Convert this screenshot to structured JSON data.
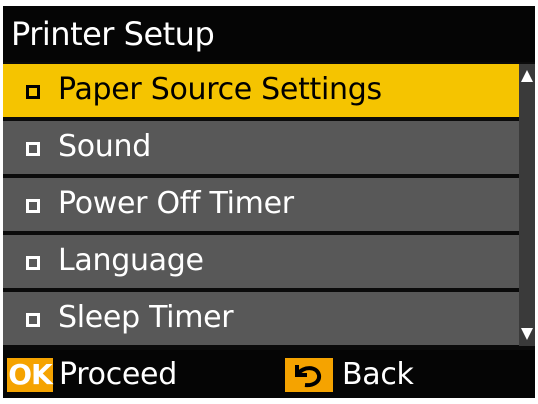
{
  "header": {
    "title": "Printer Setup"
  },
  "menu": {
    "items": [
      {
        "label": "Paper Source Settings",
        "selected": true
      },
      {
        "label": "Sound",
        "selected": false
      },
      {
        "label": "Power Off Timer",
        "selected": false
      },
      {
        "label": "Language",
        "selected": false
      },
      {
        "label": "Sleep Timer",
        "selected": false
      }
    ]
  },
  "footer": {
    "ok_badge": "OK",
    "proceed_label": "Proceed",
    "back_label": "Back",
    "back_icon": "back-arrow-icon"
  },
  "colors": {
    "selected_background": "#f5c400",
    "item_background": "#585858",
    "screen_background": "#0b0b0b",
    "button_accent": "#f5a300"
  }
}
